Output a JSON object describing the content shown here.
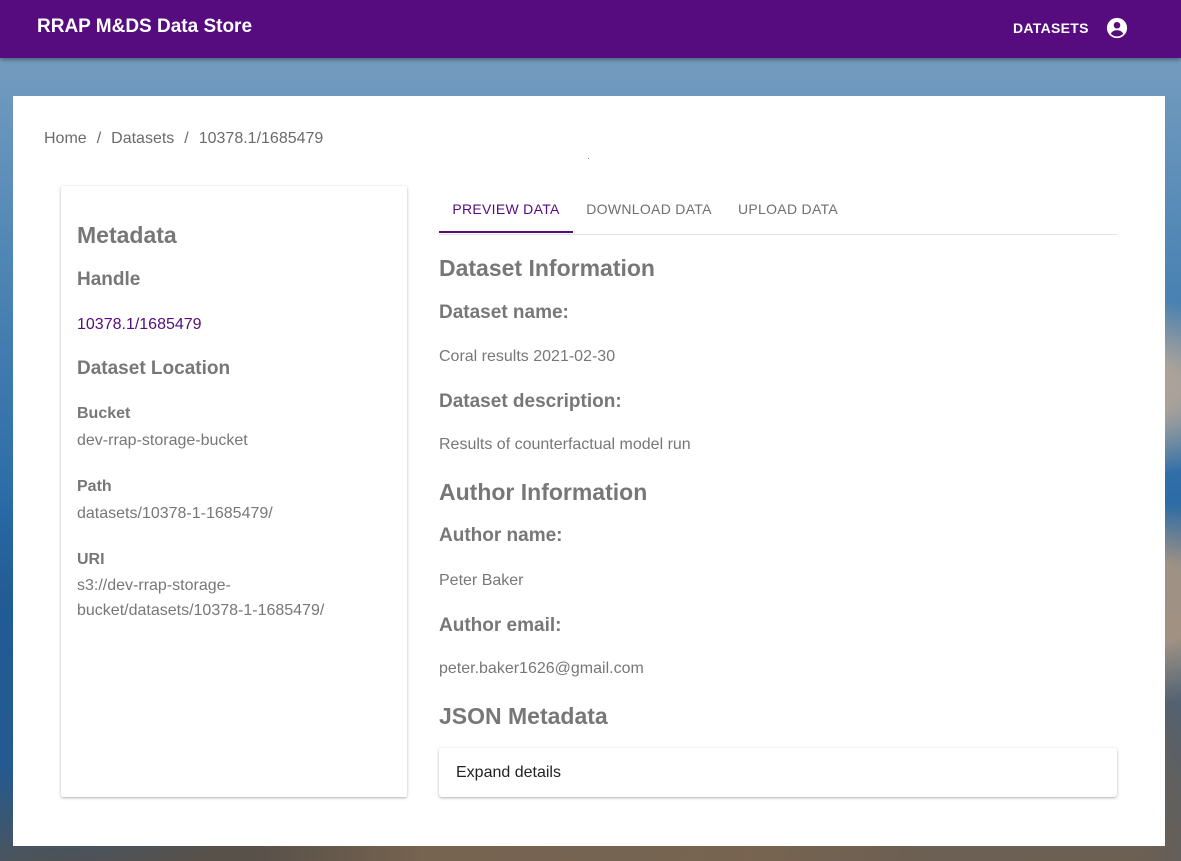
{
  "app": {
    "title": "RRAP M&DS Data Store",
    "nav_datasets": "DATASETS",
    "accent_color": "#560c7e"
  },
  "breadcrumb": {
    "items": [
      "Home",
      "Datasets",
      "10378.1/1685479"
    ],
    "separator": "/"
  },
  "metadata_panel": {
    "heading": "Metadata",
    "handle_heading": "Handle",
    "handle_value": "10378.1/1685479",
    "location_heading": "Dataset Location",
    "bucket_label": "Bucket",
    "bucket_value": "dev-rrap-storage-bucket",
    "path_label": "Path",
    "path_value": "datasets/10378-1-1685479/",
    "uri_label": "URI",
    "uri_value": "s3://dev-rrap-storage-bucket/datasets/10378-1-1685479/"
  },
  "tabs": [
    {
      "label": "PREVIEW DATA",
      "active": true
    },
    {
      "label": "DOWNLOAD DATA",
      "active": false
    },
    {
      "label": "UPLOAD DATA",
      "active": false
    }
  ],
  "dataset_info": {
    "heading": "Dataset Information",
    "name_label": "Dataset name:",
    "name_value": "Coral results 2021-02-30",
    "description_label": "Dataset description:",
    "description_value": "Results of counterfactual model run"
  },
  "author_info": {
    "heading": "Author Information",
    "name_label": "Author name:",
    "name_value": "Peter Baker",
    "email_label": "Author email:",
    "email_value": "peter.baker1626@gmail.com"
  },
  "json_metadata": {
    "heading": "JSON Metadata",
    "expand_label": "Expand details"
  }
}
